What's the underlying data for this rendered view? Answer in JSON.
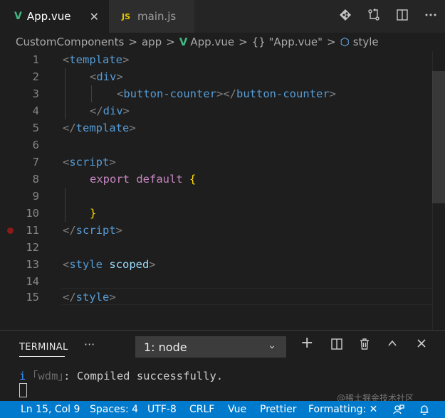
{
  "tabs": [
    {
      "label": "App.vue",
      "icon": "V",
      "close": "✕"
    },
    {
      "label": "main.js",
      "icon": "JS"
    }
  ],
  "editor_actions": [
    "git-compare-icon",
    "source-control-icon",
    "split-editor-icon",
    "more-icon"
  ],
  "breadcrumb": {
    "items": [
      "CustomComponents",
      "app",
      "App.vue",
      "{} \"App.vue\"",
      "style"
    ],
    "sep": ">",
    "vue_icon": "V",
    "cube_icon": "⬡"
  },
  "code_lines": [
    {
      "n": "1"
    },
    {
      "n": "2"
    },
    {
      "n": "3"
    },
    {
      "n": "4"
    },
    {
      "n": "5"
    },
    {
      "n": "6"
    },
    {
      "n": "7"
    },
    {
      "n": "8"
    },
    {
      "n": "9"
    },
    {
      "n": "10"
    },
    {
      "n": "11"
    },
    {
      "n": "12"
    },
    {
      "n": "13"
    },
    {
      "n": "14"
    },
    {
      "n": "15"
    }
  ],
  "code": {
    "l1_open": "<",
    "l1_tag": "template",
    "l1_close": ">",
    "l2_open": "<",
    "l2_tag": "div",
    "l2_close": ">",
    "l3_open": "<",
    "l3_tag": "button-counter",
    "l3_mid": "></",
    "l3_tag2": "button-counter",
    "l3_close": ">",
    "l4_open": "</",
    "l4_tag": "div",
    "l4_close": ">",
    "l5_open": "</",
    "l5_tag": "template",
    "l5_close": ">",
    "l7_open": "<",
    "l7_tag": "script",
    "l7_close": ">",
    "l8_kw1": "export",
    "l8_kw2": "default",
    "l8_brace": "{",
    "l10_brace": "}",
    "l11_open": "</",
    "l11_tag": "script",
    "l11_close": ">",
    "l13_open": "<",
    "l13_tag": "style",
    "l13_attr": "scoped",
    "l13_close": ">",
    "l15_open": "</",
    "l15_tag": "style",
    "l15_close": ">"
  },
  "panel": {
    "title": "TERMINAL",
    "more": "···",
    "terminal_select": "1: node",
    "chevron": "⌄",
    "buttons": {
      "add": "+",
      "split": "◫",
      "trash": "🗑",
      "maximize": "∧",
      "close": "✕"
    }
  },
  "terminal": {
    "i": "i",
    "wdm": " ｢wdm｣",
    "message": ": Compiled successfully."
  },
  "statusbar": {
    "position": "Ln 15, Col 9",
    "spaces": "Spaces: 4",
    "encoding": "UTF-8",
    "eol": "CRLF",
    "language": "Vue",
    "prettier": "Prettier",
    "formatting": "Formatting: ✕",
    "feedback_icon": "⚑",
    "bell_icon": "🔔"
  },
  "watermark": "@稀土掘金技术社区",
  "colors": {
    "accent": "#007acc",
    "vue_green": "#41b883",
    "tag_blue": "#569cd6",
    "keyword_purple": "#c586c0",
    "bracket_gold": "#ffd700",
    "attr_blue": "#9cdcfe",
    "breakpoint": "#8b1a1a"
  }
}
